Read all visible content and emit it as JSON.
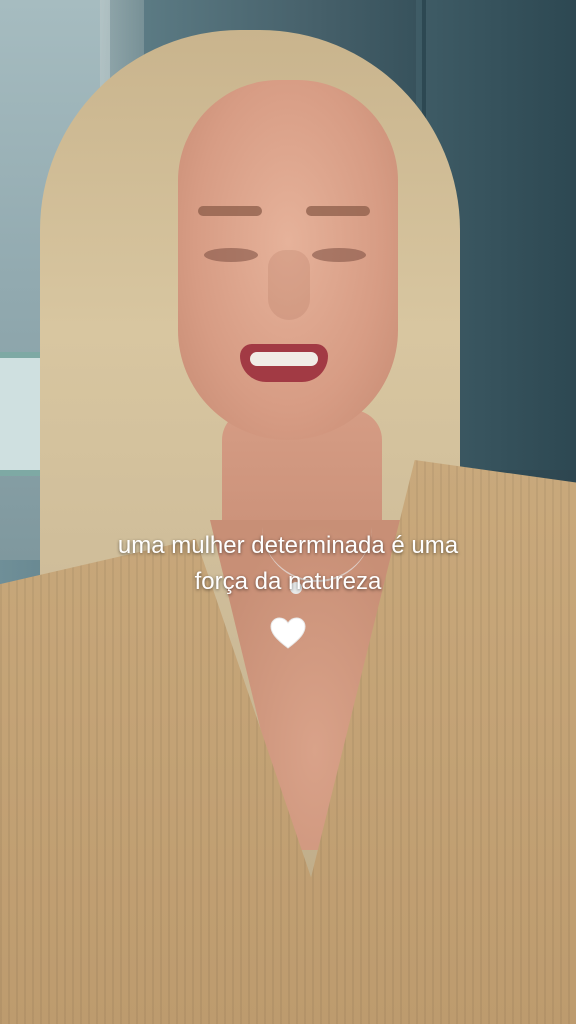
{
  "caption": {
    "line1": "uma mulher determinada é uma",
    "line2": "força da natureza",
    "emoji": "🤍"
  },
  "colors": {
    "caption_text": "#ffffff",
    "sweater": "#c9a97c",
    "wall": "#46606a"
  }
}
